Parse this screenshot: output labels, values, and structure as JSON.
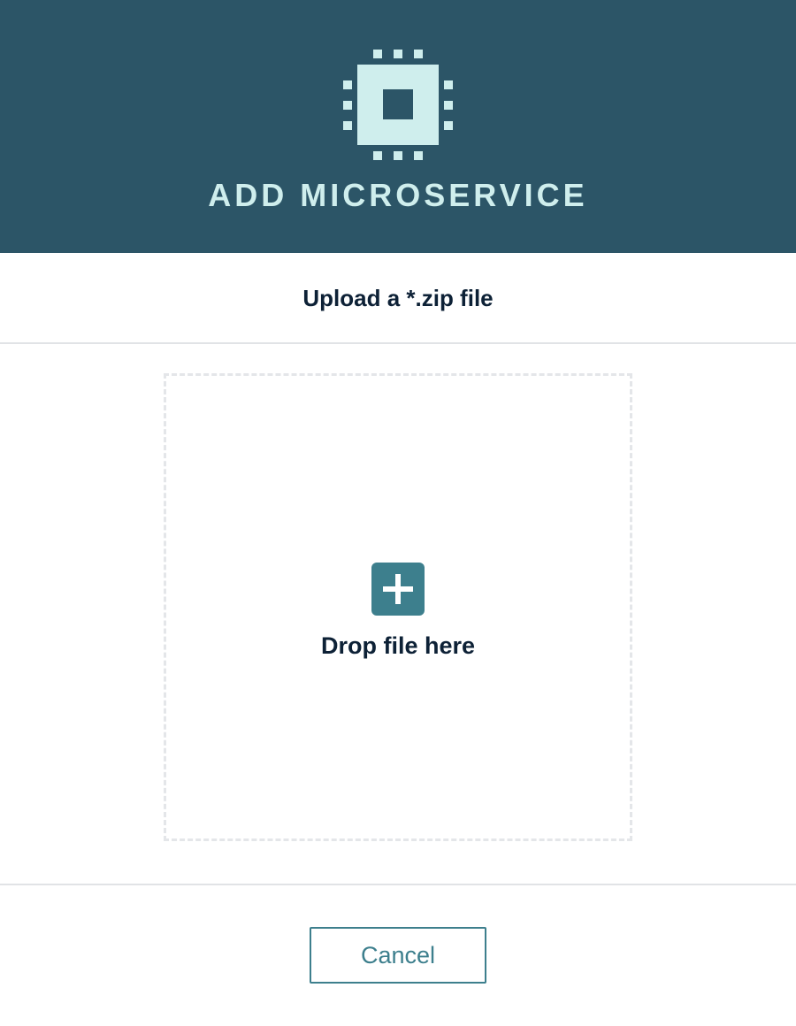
{
  "dialog": {
    "title": "ADD MICROSERVICE",
    "title_icon": "microchip-icon",
    "subtitle": "Upload a *.zip file"
  },
  "dropzone": {
    "icon": "plus-square-icon",
    "label": "Drop file here"
  },
  "footer": {
    "cancel_label": "Cancel"
  },
  "colors": {
    "header_bg": "#2c5567",
    "header_fg": "#cfeeed",
    "accent": "#3d7f8d",
    "text_dark": "#0d2136",
    "divider": "#e1e3e6"
  }
}
